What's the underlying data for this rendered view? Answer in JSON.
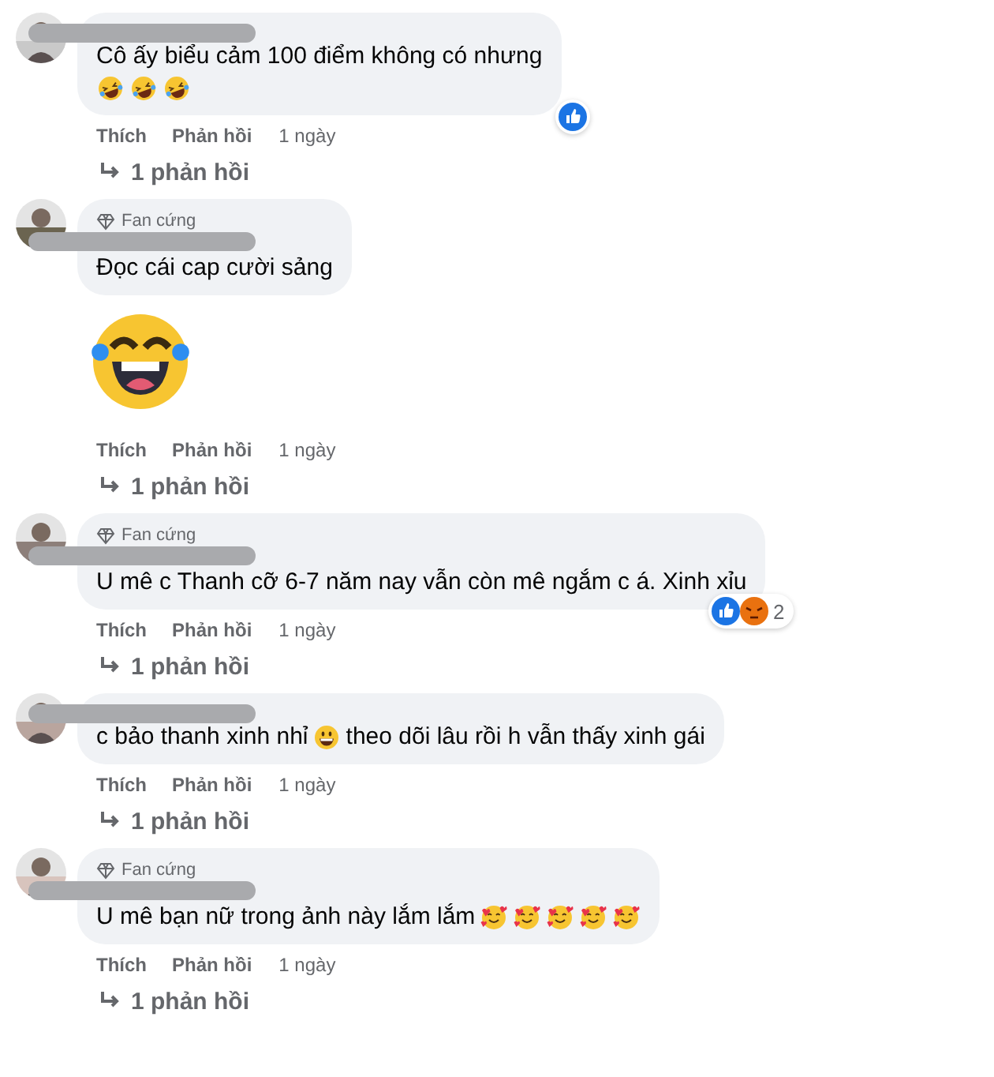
{
  "comments": [
    {
      "lines": [
        [
          {
            "kind": "text",
            "text": "Cô ấy biểu cảm 100 điểm không có nhưng"
          }
        ],
        [
          {
            "kind": "laughing-emoji"
          },
          {
            "kind": "laughing-emoji"
          },
          {
            "kind": "laughing-emoji"
          }
        ]
      ],
      "reactions": {
        "icons": [
          {
            "kind": "like"
          }
        ]
      },
      "actions": [
        "Thích",
        "Phản hồi"
      ],
      "time": "1 ngày",
      "replies": "1 phản hồi"
    },
    {
      "badge": "Fan cứng",
      "lines": [
        [
          {
            "kind": "text",
            "text": "Đọc cái cap cười sảng"
          }
        ]
      ],
      "sticker": {
        "kind": "tears-of-joy"
      },
      "actions": [
        "Thích",
        "Phản hồi"
      ],
      "time": "1 ngày",
      "replies": "1 phản hồi"
    },
    {
      "badge": "Fan cứng",
      "lines": [
        [
          {
            "kind": "text",
            "text": "U mê c Thanh cỡ 6-7 năm nay vẫn còn mê ngắm c á. Xinh xỉu"
          }
        ]
      ],
      "reactions": {
        "icons": [
          {
            "kind": "like"
          },
          {
            "kind": "angry"
          }
        ],
        "count": "2"
      },
      "actions": [
        "Thích",
        "Phản hồi"
      ],
      "time": "1 ngày",
      "replies": "1 phản hồi"
    },
    {
      "lines": [
        [
          {
            "kind": "text",
            "text": "c bảo thanh xinh nhỉ"
          },
          {
            "kind": "grin"
          },
          {
            "kind": "text",
            "text": "theo dõi lâu rồi h vẫn thấy xinh gái"
          }
        ]
      ],
      "actions": [
        "Thích",
        "Phản hồi"
      ],
      "time": "1 ngày",
      "replies": "1 phản hồi"
    },
    {
      "badge": "Fan cứng",
      "lines": [
        [
          {
            "kind": "text",
            "text": "U mê bạn nữ trong ảnh này lắm lắm"
          },
          {
            "kind": "hearts"
          },
          {
            "kind": "hearts"
          },
          {
            "kind": "hearts"
          },
          {
            "kind": "hearts"
          },
          {
            "kind": "hearts"
          }
        ]
      ],
      "actions": [
        "Thích",
        "Phản hồi"
      ],
      "time": "1 ngày",
      "replies": "1 phản hồi"
    }
  ]
}
